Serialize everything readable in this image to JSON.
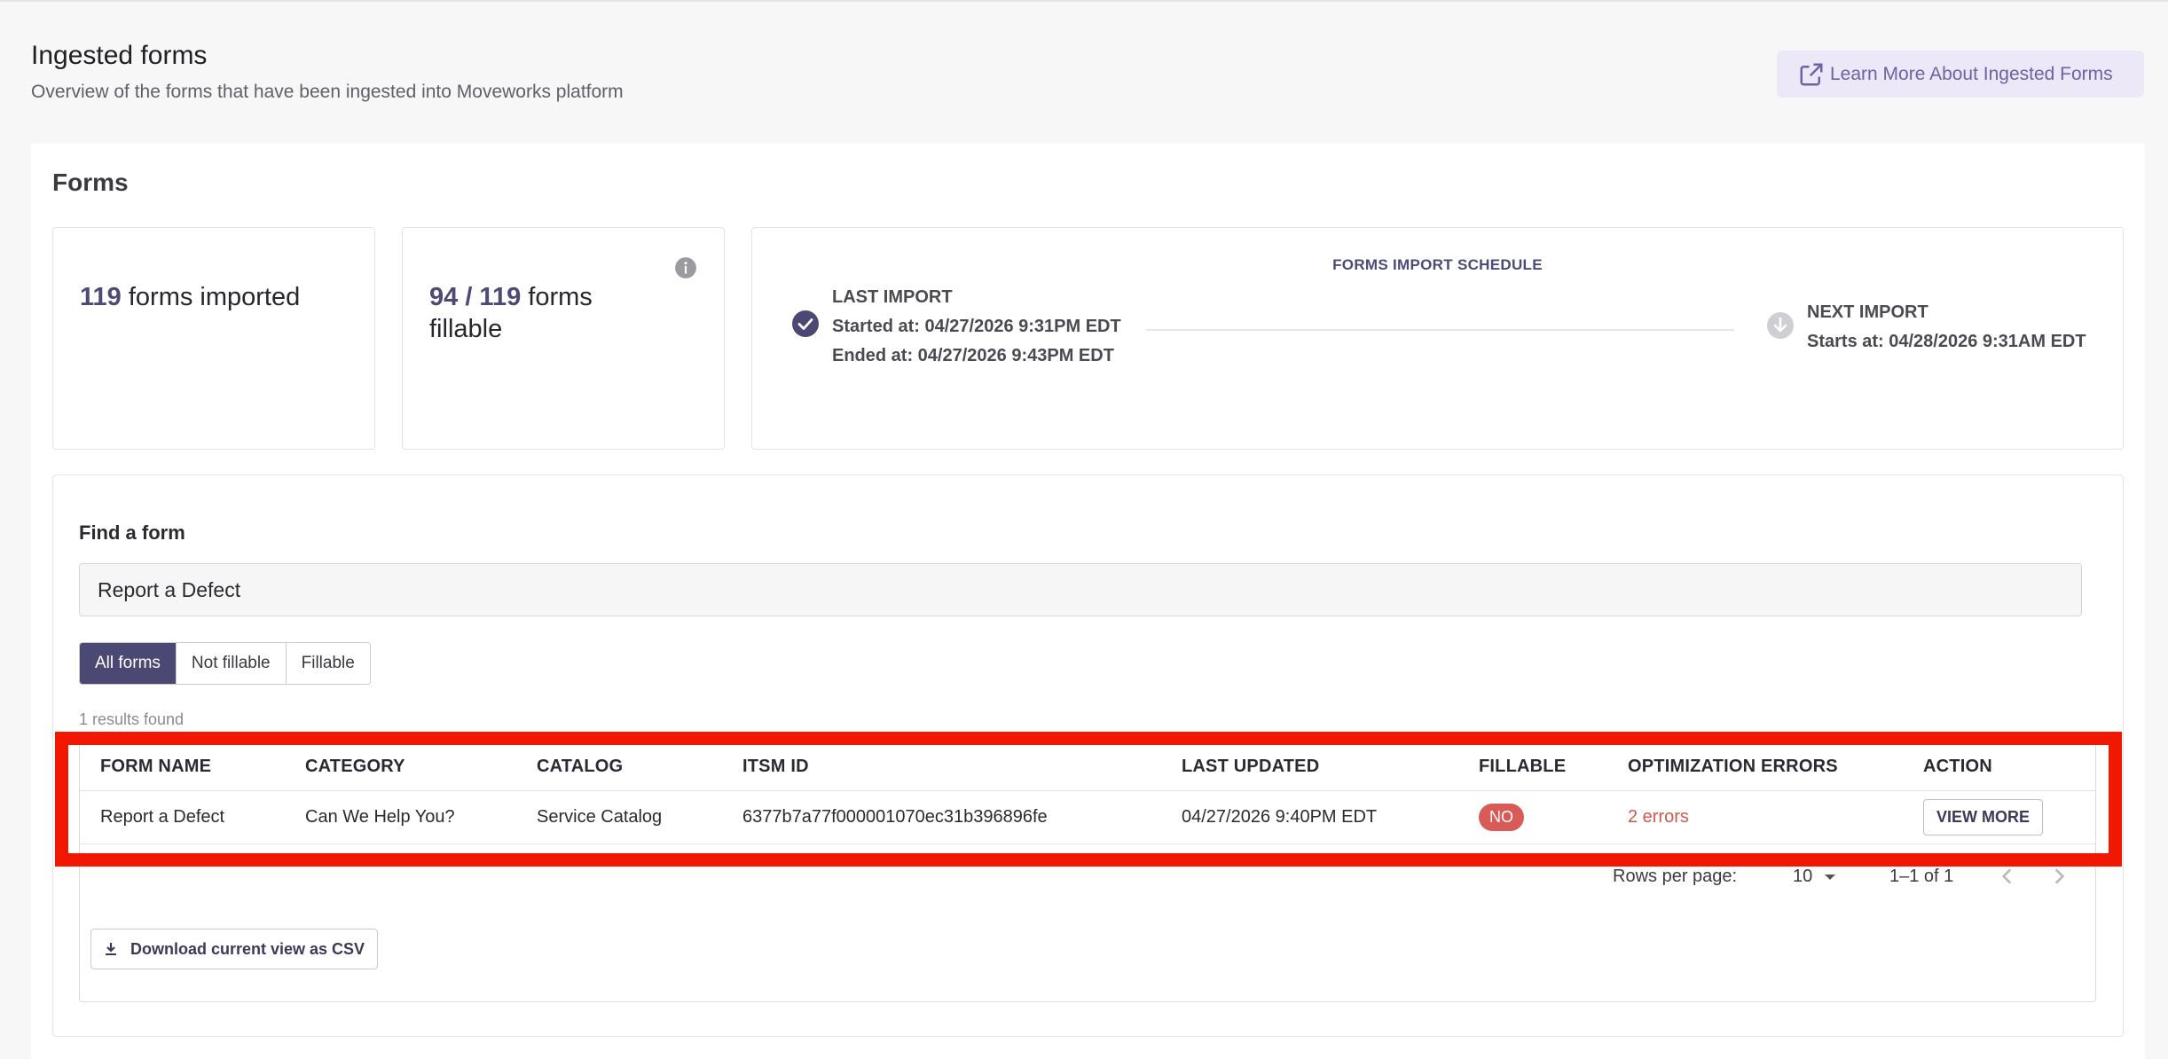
{
  "header": {
    "title": "Ingested forms",
    "subtitle": "Overview of the forms that have been ingested into Moveworks platform",
    "learn_more": "Learn More About Ingested Forms"
  },
  "forms_section": {
    "title": "Forms",
    "imported": {
      "count": "119",
      "label": "forms imported"
    },
    "fillable": {
      "count": "94 / 119",
      "label": "forms fillable"
    },
    "schedule": {
      "title": "FORMS IMPORT SCHEDULE",
      "last_import_label": "LAST IMPORT",
      "last_started": "Started at: 04/27/2026 9:31PM EDT",
      "last_ended": "Ended at: 04/27/2026 9:43PM EDT",
      "next_import_label": "NEXT IMPORT",
      "next_starts": "Starts at: 04/28/2026 9:31AM EDT"
    }
  },
  "find": {
    "label": "Find a form",
    "search_value": "Report a Defect",
    "filters": [
      "All forms",
      "Not fillable",
      "Fillable"
    ],
    "active_filter": "All forms",
    "results_text": "1 results found"
  },
  "table": {
    "headers": [
      "FORM NAME",
      "CATEGORY",
      "CATALOG",
      "ITSM ID",
      "LAST UPDATED",
      "FILLABLE",
      "OPTIMIZATION ERRORS",
      "ACTION"
    ],
    "rows": [
      {
        "form_name": "Report a Defect",
        "category": "Can We Help You?",
        "catalog": "Service Catalog",
        "itsm_id": "6377b7a77f000001070ec31b396896fe",
        "last_updated": "04/27/2026 9:40PM EDT",
        "fillable": "NO",
        "errors": "2 errors",
        "action": "VIEW MORE"
      }
    ]
  },
  "pagination": {
    "rows_per_page_label": "Rows per page:",
    "rows_per_page": "10",
    "range": "1–1 of 1"
  },
  "csv_button": "Download current view as CSV",
  "colors": {
    "accent": "#4b4874",
    "highlight": "#f21800",
    "badge_no": "#d95b58",
    "error_text": "#d0584f",
    "learn_button_bg": "#ece8f7"
  },
  "icons": [
    "external-link-icon",
    "info-icon",
    "check-circle-icon",
    "arrow-down-circle-icon",
    "caret-down-icon",
    "chevron-left-icon",
    "chevron-right-icon",
    "download-icon"
  ]
}
